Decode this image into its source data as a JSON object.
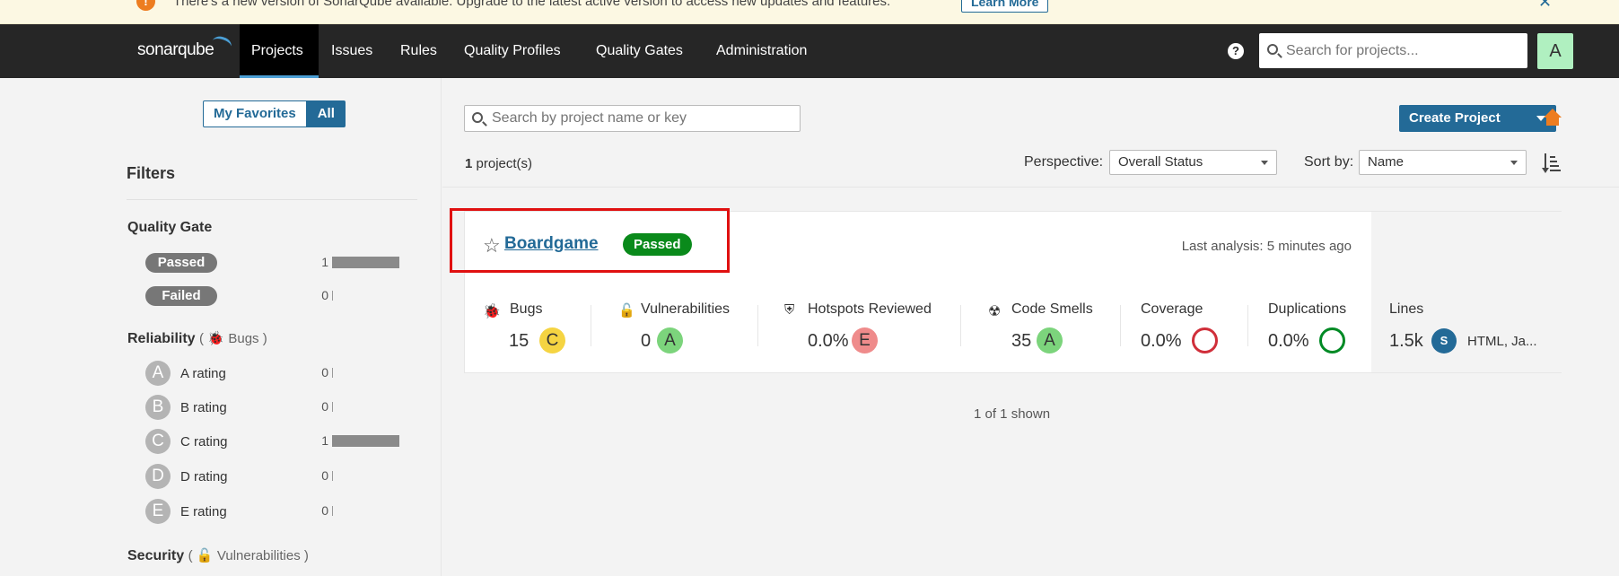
{
  "banner": {
    "text": "There's a new version of SonarQube available. Upgrade to the latest active version to access new updates and features.",
    "learn_more": "Learn More",
    "icon": "info-icon"
  },
  "nav": {
    "logo": "sonarqube",
    "items": [
      "Projects",
      "Issues",
      "Rules",
      "Quality Profiles",
      "Quality Gates",
      "Administration"
    ],
    "active": "Projects",
    "search_placeholder": "Search for projects...",
    "avatar": "A"
  },
  "sidebar": {
    "toggle": [
      "My Favorites",
      "All"
    ],
    "filters_title": "Filters",
    "quality_gate": {
      "title": "Quality Gate",
      "items": [
        {
          "label": "Passed",
          "count": "1",
          "fraction": 1
        },
        {
          "label": "Failed",
          "count": "0",
          "fraction": 0
        }
      ]
    },
    "reliability": {
      "title": "Reliability",
      "sub": "Bugs",
      "items": [
        {
          "letter": "A",
          "label": "A rating",
          "count": "0",
          "fraction": 0
        },
        {
          "letter": "B",
          "label": "B rating",
          "count": "0",
          "fraction": 0
        },
        {
          "letter": "C",
          "label": "C rating",
          "count": "1",
          "fraction": 1
        },
        {
          "letter": "D",
          "label": "D rating",
          "count": "0",
          "fraction": 0
        },
        {
          "letter": "E",
          "label": "E rating",
          "count": "0",
          "fraction": 0
        }
      ]
    },
    "security": {
      "title": "Security",
      "sub": "Vulnerabilities"
    }
  },
  "main": {
    "search_placeholder": "Search by project name or key",
    "create_project": "Create Project",
    "count": "1",
    "count_suffix": " project(s)",
    "perspective_label": "Perspective:",
    "perspective_value": "Overall Status",
    "sortby_label": "Sort by:",
    "sortby_value": "Name",
    "shown": "1 of 1 shown"
  },
  "project": {
    "name": "Boardgame",
    "quality_gate": "Passed",
    "last_analysis": "Last analysis: 5 minutes ago",
    "metrics": {
      "bugs": {
        "label": "Bugs",
        "value": "15",
        "rating": "C"
      },
      "vulnerabilities": {
        "label": "Vulnerabilities",
        "value": "0",
        "rating": "A"
      },
      "hotspots": {
        "label": "Hotspots Reviewed",
        "value": "0.0%",
        "rating": "E"
      },
      "code_smells": {
        "label": "Code Smells",
        "value": "35",
        "rating": "A"
      },
      "coverage": {
        "label": "Coverage",
        "value": "0.0%"
      },
      "duplications": {
        "label": "Duplications",
        "value": "0.0%"
      },
      "lines": {
        "label": "Lines",
        "value": "1.5k",
        "size": "S",
        "languages": "HTML, Ja..."
      }
    }
  },
  "colors": {
    "accent": "#236a97",
    "rating_A": "#7cd47c",
    "rating_C": "#f5d442",
    "rating_E": "#ef8b8b",
    "coverage_ring": "#d02f3a",
    "duplication_ring": "#008a25",
    "passed": "#0a8a1b",
    "highlight": "#e01010"
  }
}
